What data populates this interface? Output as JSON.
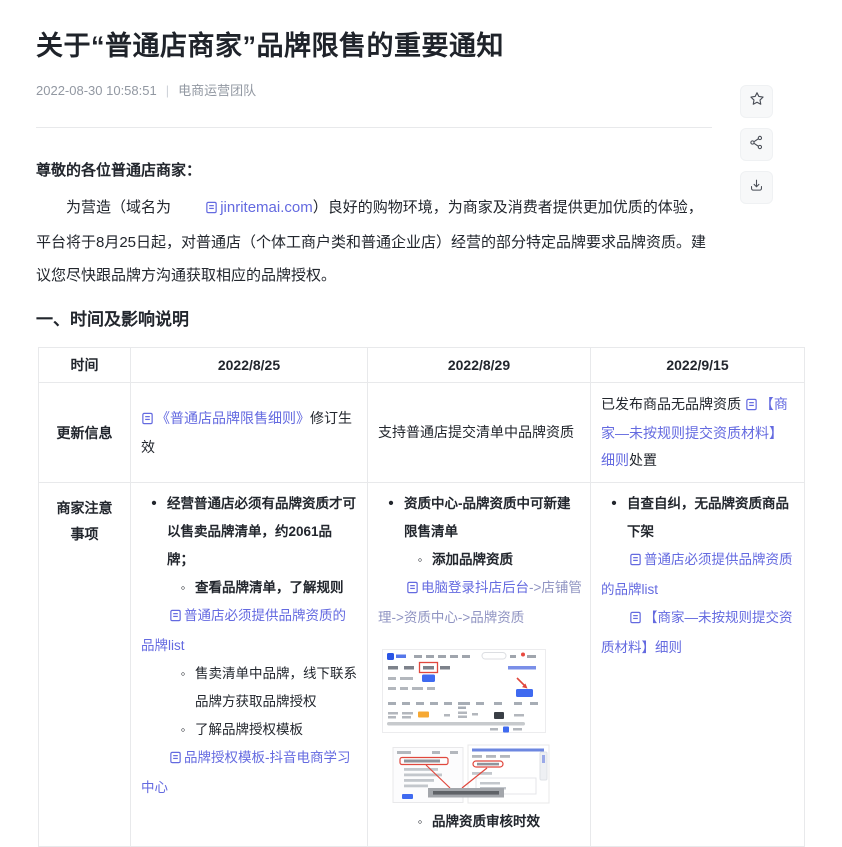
{
  "article": {
    "title": "关于“普通店商家”品牌限售的重要通知",
    "date": "2022-08-30 10:58:51",
    "meta_separator": "|",
    "author": "电商运营团队",
    "salutation": "尊敬的各位普通店商家：",
    "intro": {
      "before_link": "为营造（域名为",
      "domain_link": "jinritemai.com",
      "after_link": "）良好的购物环境，为商家及消费者提供更加优质的体验，平台将于8月25日起，对普通店（个体工商户类和普通企业店）经营的部分特定品牌要求品牌资质。建议您尽快跟品牌方沟通获取相应的品牌授权。"
    },
    "section_heading": "一、时间及影响说明"
  },
  "actions": {
    "favorite_icon": "star-icon",
    "share_icon": "share-icon",
    "download_icon": "download-icon"
  },
  "glyphs": {
    "bullet_l1": "•",
    "bullet_l2": "◦"
  },
  "table": {
    "headers": [
      "时间",
      "2022/8/25",
      "2022/8/29",
      "2022/9/15"
    ],
    "row_update": {
      "label": "更新信息",
      "c1": {
        "link": "《普通店品牌限售细则》",
        "suffix": "修订生效"
      },
      "c2": "支持普通店提交清单中品牌资质",
      "c3": {
        "prefix": "已发布商品无品牌资质",
        "link": "【商家—未按规则提交资质材料】细则",
        "suffix": "处置"
      }
    },
    "row_notes": {
      "label": "商家注意事项",
      "c1": {
        "b1": "经营普通店必须有品牌资质才可以售卖品牌清单，约2061品牌；",
        "b2": "查看品牌清单，了解规则",
        "link1": "普通店必须提供品牌资质的品牌list",
        "b3": "售卖清单中品牌，线下联系品牌方获取品牌授权",
        "b4": "了解品牌授权模板",
        "link2": "品牌授权模板-抖音电商学习中心"
      },
      "c2": {
        "b1": "资质中心-品牌资质中可新建限售清单",
        "b2": "添加品牌资质",
        "link1": "电脑登录抖店后台",
        "path_suffix": "->店铺管理->资质中心->品牌资质",
        "b3": "品牌资质审核时效"
      },
      "c3": {
        "b1": "自查自纠，无品牌资质商品下架",
        "link1": "普通店必须提供品牌资质的品牌list",
        "link2": "【商家—未按规则提交资质材料】细则"
      }
    }
  },
  "colors": {
    "link": "#646ae0",
    "text": "#22262d",
    "meta_gray": "#9298a2",
    "border": "#e8e9eb",
    "annotation_red": "#e0473d",
    "button_blue": "#3f6af0",
    "badge_orange": "#f6a833"
  }
}
